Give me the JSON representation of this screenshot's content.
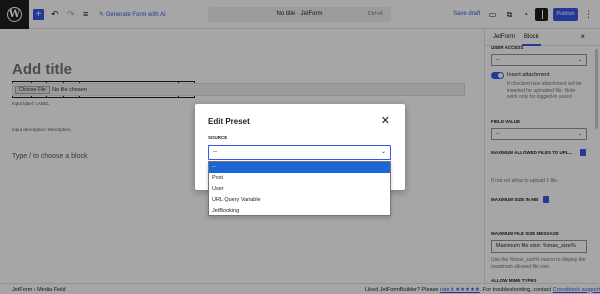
{
  "toolbar": {
    "generate_label": "Generate Form with AI",
    "title": "No title · JetForm",
    "shortcut": "Ctrl+K",
    "save_draft": "Save draft",
    "publish": "Publish"
  },
  "editor": {
    "add_title": "Add title",
    "field_name_value": "field_name",
    "input_label": "Input label: LABEL",
    "file_button": "Choose File",
    "file_status": "No file chosen",
    "input_description": "Input description:  Description...",
    "placeholder": "Type / to choose a block"
  },
  "sidebar": {
    "tabs": [
      "JetForm",
      "Block"
    ],
    "user_access_label": "USER ACCESS",
    "user_access_value": "--",
    "insert_attachment": "Insert attachment",
    "insert_help": "If checked new attachment will be inserted for uploaded file. Note: work only for logged-in users!",
    "field_value_label": "FIELD VALUE",
    "field_value_value": "--",
    "max_files_label": "MAXIMUM ALLOWED FILES TO UPL...",
    "max_files_help": "If not set allow to upload 1 file.",
    "max_size_label": "MAXIMUM SIZE IN MB",
    "max_size_msg_label": "MAXIMUM FILE SIZE MESSAGE",
    "max_size_msg_value": "Maximum file size: %max_size%",
    "max_size_msg_help": "Use the %max_size% macro to display the maximum allowed file size.",
    "allow_mime_label": "ALLOW MIME TYPES"
  },
  "bottombar": {
    "crumb_1": "JetForm",
    "crumb_sep": "›",
    "crumb_2": "Media Field",
    "msg_prefix": "Liked JetFormBuilder? Please",
    "msg_rate": "rate it ★★★★★",
    "msg_mid": ". For troubleshooting, contact",
    "msg_support": "Crocoblock support"
  },
  "modal": {
    "title": "Edit Preset",
    "source_label": "SOURCE",
    "source_value": "--",
    "options": [
      "--",
      "Post",
      "User",
      "URL Query Variable",
      "JetBooking"
    ]
  }
}
